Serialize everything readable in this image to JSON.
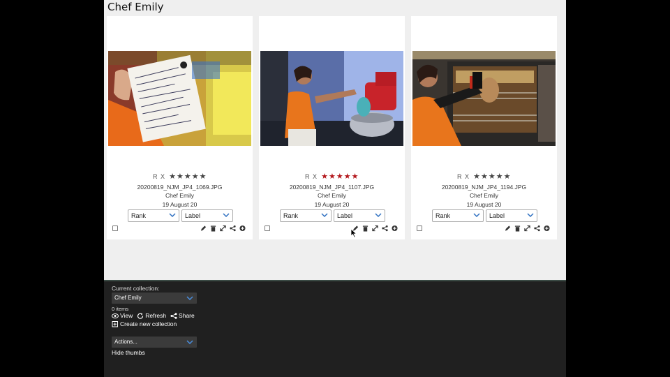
{
  "page": {
    "title": "Chef Emily"
  },
  "colors": {
    "star_active": "#b3161b",
    "star_inactive": "#444444",
    "panel_bg": "#202020",
    "app_bg": "#efefef"
  },
  "cards": [
    {
      "rx": "R X",
      "stars_filled": 0,
      "stars_total": 5,
      "filename": "20200819_NJM_JP4_1069.JPG",
      "owner": "Chef Emily",
      "date": "19 August 20",
      "rank_value": "Rank",
      "label_value": "Label",
      "photo": "person-holding-handwritten-recipe-sheet"
    },
    {
      "rx": "R X",
      "stars_filled": 5,
      "stars_total": 5,
      "filename": "20200819_NJM_JP4_1107.JPG",
      "owner": "Chef Emily",
      "date": "19 August 20",
      "rank_value": "Rank",
      "label_value": "Label",
      "photo": "chef-pouring-into-mixing-bowl"
    },
    {
      "rx": "R X",
      "stars_filled": 0,
      "stars_total": 5,
      "filename": "20200819_NJM_JP4_1194.JPG",
      "owner": "Chef Emily",
      "date": "19 August 20",
      "rank_value": "Rank",
      "label_value": "Label",
      "photo": "chef-taking-bread-from-oven"
    }
  ],
  "card_tools": [
    "pencil-icon",
    "trash-icon",
    "expand-icon",
    "share-icon",
    "plus-circle-icon"
  ],
  "panel": {
    "current_collection_label": "Current collection:",
    "collection_select": "Chef Emily",
    "item_count": "0 items",
    "view_label": "View",
    "refresh_label": "Refresh",
    "share_label": "Share",
    "create_label": "Create new collection",
    "actions_select": "Actions...",
    "hide_thumbs_label": "Hide thumbs"
  }
}
